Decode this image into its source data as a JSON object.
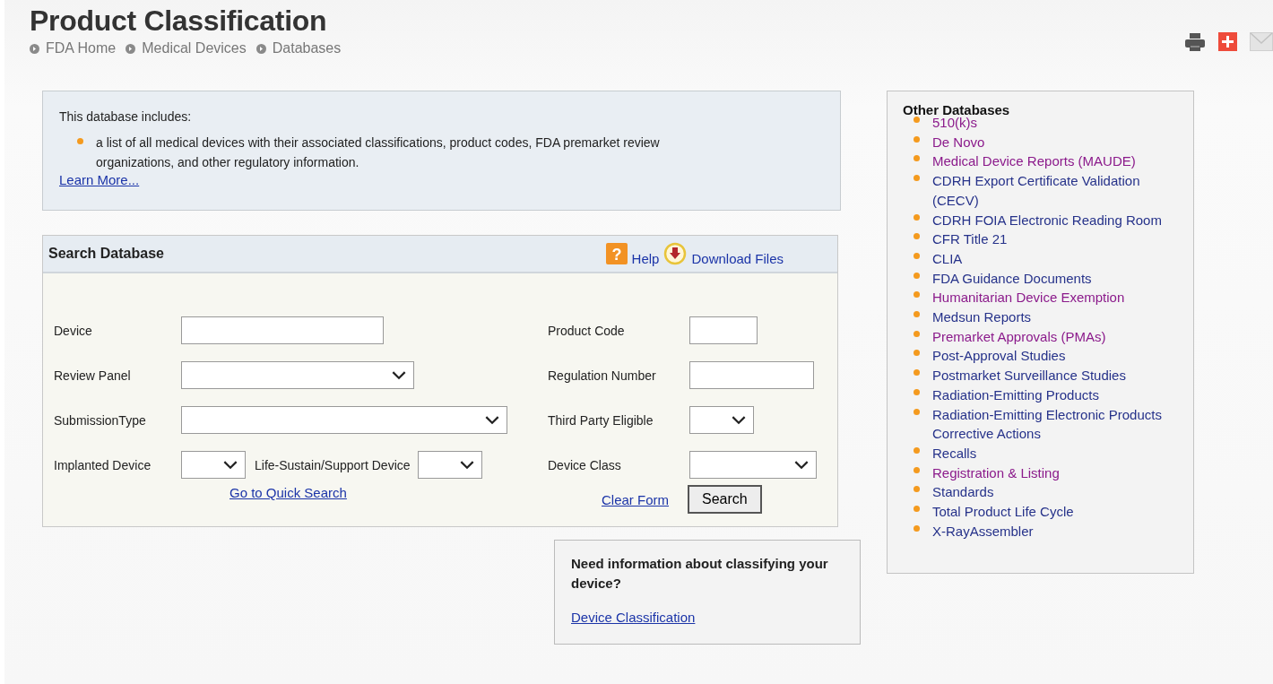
{
  "header": {
    "title": "Product Classification",
    "breadcrumbs": [
      "FDA Home",
      "Medical Devices",
      "Databases"
    ]
  },
  "info": {
    "heading": "This database includes:",
    "bullets": [
      "a list of all medical devices with their associated classifications, product codes, FDA premarket review organizations, and other regulatory information."
    ],
    "link": "Learn More..."
  },
  "search": {
    "title": "Search Database",
    "help_glyph": "?",
    "help": "Help",
    "download": "Download Files",
    "left_fields": [
      {
        "label": "Device",
        "kind": "text"
      },
      {
        "label": "Review Panel",
        "kind": "select"
      },
      {
        "label": "SubmissionType",
        "kind": "select"
      }
    ],
    "implanted": {
      "label": "Implanted Device",
      "kind": "select"
    },
    "life_sustain": {
      "label": "Life-Sustain/Support Device",
      "kind": "select"
    },
    "right_fields": [
      {
        "label": "Product Code",
        "kind": "text"
      },
      {
        "label": "Regulation Number",
        "kind": "text"
      },
      {
        "label": "Third Party Eligible",
        "kind": "select"
      },
      {
        "label": "Device Class",
        "kind": "select"
      }
    ],
    "quick_search_link": "Go to Quick Search",
    "clear_link": "Clear Form",
    "search_button": "Search"
  },
  "classify_box": {
    "question": "Need information about classifying your device?",
    "link": "Device Classification"
  },
  "other_databases": {
    "title": "Other Databases",
    "items": [
      {
        "label": "510(k)s",
        "visited": true
      },
      {
        "label": "De Novo",
        "visited": true
      },
      {
        "label": "Medical Device Reports (MAUDE)",
        "visited": true
      },
      {
        "label": "CDRH Export Certificate Validation (CECV)",
        "visited": false
      },
      {
        "label": "CDRH FOIA Electronic Reading Room",
        "visited": false
      },
      {
        "label": "CFR Title 21",
        "visited": false
      },
      {
        "label": "CLIA",
        "visited": false
      },
      {
        "label": "FDA Guidance Documents",
        "visited": false
      },
      {
        "label": "Humanitarian Device Exemption",
        "visited": true
      },
      {
        "label": "Medsun Reports",
        "visited": false
      },
      {
        "label": "Premarket Approvals (PMAs)",
        "visited": true
      },
      {
        "label": "Post-Approval Studies",
        "visited": false
      },
      {
        "label": "Postmarket Surveillance Studies",
        "visited": false
      },
      {
        "label": "Radiation-Emitting Products",
        "visited": false
      },
      {
        "label": "Radiation-Emitting Electronic Products Corrective Actions",
        "visited": false
      },
      {
        "label": "Recalls",
        "visited": false
      },
      {
        "label": "Registration & Listing",
        "visited": true
      },
      {
        "label": "Standards",
        "visited": false
      },
      {
        "label": "Total Product Life Cycle",
        "visited": false
      },
      {
        "label": "X-RayAssembler",
        "visited": false
      }
    ]
  }
}
